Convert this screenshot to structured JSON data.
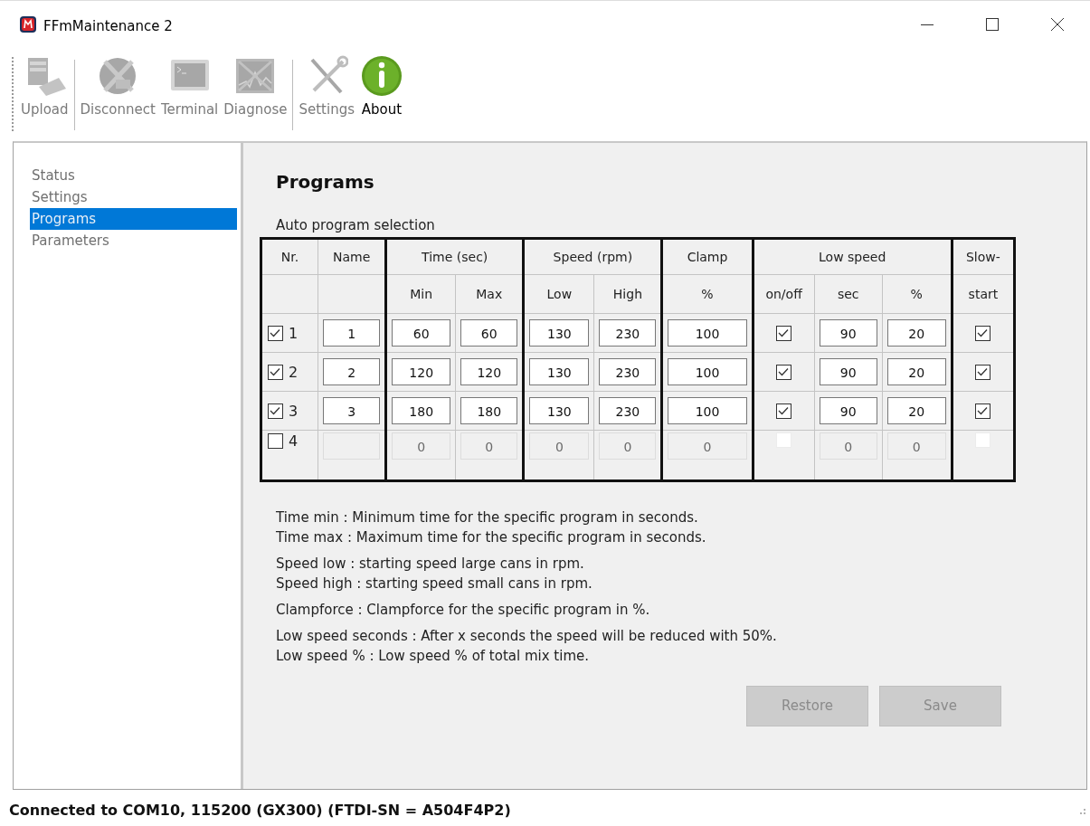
{
  "window": {
    "title": "FFmMaintenance 2"
  },
  "toolbar": {
    "groups": [
      [
        {
          "label": "Upload",
          "kind": "upload",
          "disabled": true
        }
      ],
      [
        {
          "label": "Disconnect",
          "kind": "disconnect",
          "disabled": true
        },
        {
          "label": "Terminal",
          "kind": "terminal",
          "disabled": true
        },
        {
          "label": "Diagnose",
          "kind": "diagnose",
          "disabled": true
        }
      ],
      [
        {
          "label": "Settings",
          "kind": "settings",
          "disabled": true
        },
        {
          "label": "About",
          "kind": "about",
          "disabled": false
        }
      ]
    ]
  },
  "sidebar": {
    "items": [
      {
        "label": "Status",
        "selected": false
      },
      {
        "label": "Settings",
        "selected": false
      },
      {
        "label": "Programs",
        "selected": true
      },
      {
        "label": "Parameters",
        "selected": false
      }
    ]
  },
  "content": {
    "title": "Programs",
    "section": "Auto program selection",
    "table": {
      "groups": [
        {
          "label": "Nr."
        },
        {
          "label": "Name"
        },
        {
          "label": "Time (sec)",
          "columns": [
            "Min",
            "Max"
          ]
        },
        {
          "label": "Speed (rpm)",
          "columns": [
            "Low",
            "High"
          ]
        },
        {
          "label": "Clamp",
          "columns": [
            "%"
          ]
        },
        {
          "label": "Low speed",
          "columns": [
            "on/off",
            "sec",
            "%"
          ]
        },
        {
          "label": "Slow-",
          "columns": [
            "start"
          ]
        }
      ],
      "rows": [
        {
          "checked": true,
          "number": "1",
          "cells": [
            {
              "kind": "field",
              "value": "1"
            },
            {
              "kind": "field",
              "value": "60"
            },
            {
              "kind": "field",
              "value": "60"
            },
            {
              "kind": "field",
              "value": "130"
            },
            {
              "kind": "field",
              "value": "230"
            },
            {
              "kind": "field",
              "value": "100"
            },
            {
              "kind": "check",
              "checked": true
            },
            {
              "kind": "field",
              "value": "90"
            },
            {
              "kind": "field",
              "value": "20"
            },
            {
              "kind": "check",
              "checked": true
            }
          ]
        },
        {
          "checked": true,
          "number": "2",
          "cells": [
            {
              "kind": "field",
              "value": "2"
            },
            {
              "kind": "field",
              "value": "120"
            },
            {
              "kind": "field",
              "value": "120"
            },
            {
              "kind": "field",
              "value": "130"
            },
            {
              "kind": "field",
              "value": "230"
            },
            {
              "kind": "field",
              "value": "100"
            },
            {
              "kind": "check",
              "checked": true
            },
            {
              "kind": "field",
              "value": "90"
            },
            {
              "kind": "field",
              "value": "20"
            },
            {
              "kind": "check",
              "checked": true
            }
          ]
        },
        {
          "checked": true,
          "number": "3",
          "cells": [
            {
              "kind": "field",
              "value": "3"
            },
            {
              "kind": "field",
              "value": "180"
            },
            {
              "kind": "field",
              "value": "180"
            },
            {
              "kind": "field",
              "value": "130"
            },
            {
              "kind": "field",
              "value": "230"
            },
            {
              "kind": "field",
              "value": "100"
            },
            {
              "kind": "check",
              "checked": true
            },
            {
              "kind": "field",
              "value": "90"
            },
            {
              "kind": "field",
              "value": "20"
            },
            {
              "kind": "check",
              "checked": true
            }
          ]
        },
        {
          "checked": false,
          "number": "4",
          "cells": [
            {
              "kind": "field"
            },
            {
              "kind": "field",
              "value": "0"
            },
            {
              "kind": "field",
              "value": "0"
            },
            {
              "kind": "field",
              "value": "0"
            },
            {
              "kind": "field",
              "value": "0"
            },
            {
              "kind": "field",
              "value": "0"
            },
            {
              "kind": "check",
              "checked": false
            },
            {
              "kind": "field",
              "value": "0"
            },
            {
              "kind": "field",
              "value": "0"
            },
            {
              "kind": "check",
              "checked": false
            }
          ]
        }
      ]
    },
    "descriptions": [
      [
        "Time min : Minimum time for the specific program in seconds.",
        "Time max : Maximum time for the specific program in seconds."
      ],
      [
        "Speed low : starting speed large cans in rpm.",
        "Speed high : starting speed small cans in rpm."
      ],
      [
        "Clampforce : Clampforce for the specific program in %."
      ],
      [
        "Low speed seconds : After x seconds the speed will be reduced with 50%.",
        "Low speed % : Low speed % of total mix time."
      ]
    ],
    "buttons": [
      {
        "label": "Restore",
        "disabled": true
      },
      {
        "label": "Save",
        "disabled": true
      }
    ]
  },
  "status_bar": {
    "text": "Connected to COM10, 115200 (GX300) (FTDI-SN = A504F4P2)"
  }
}
